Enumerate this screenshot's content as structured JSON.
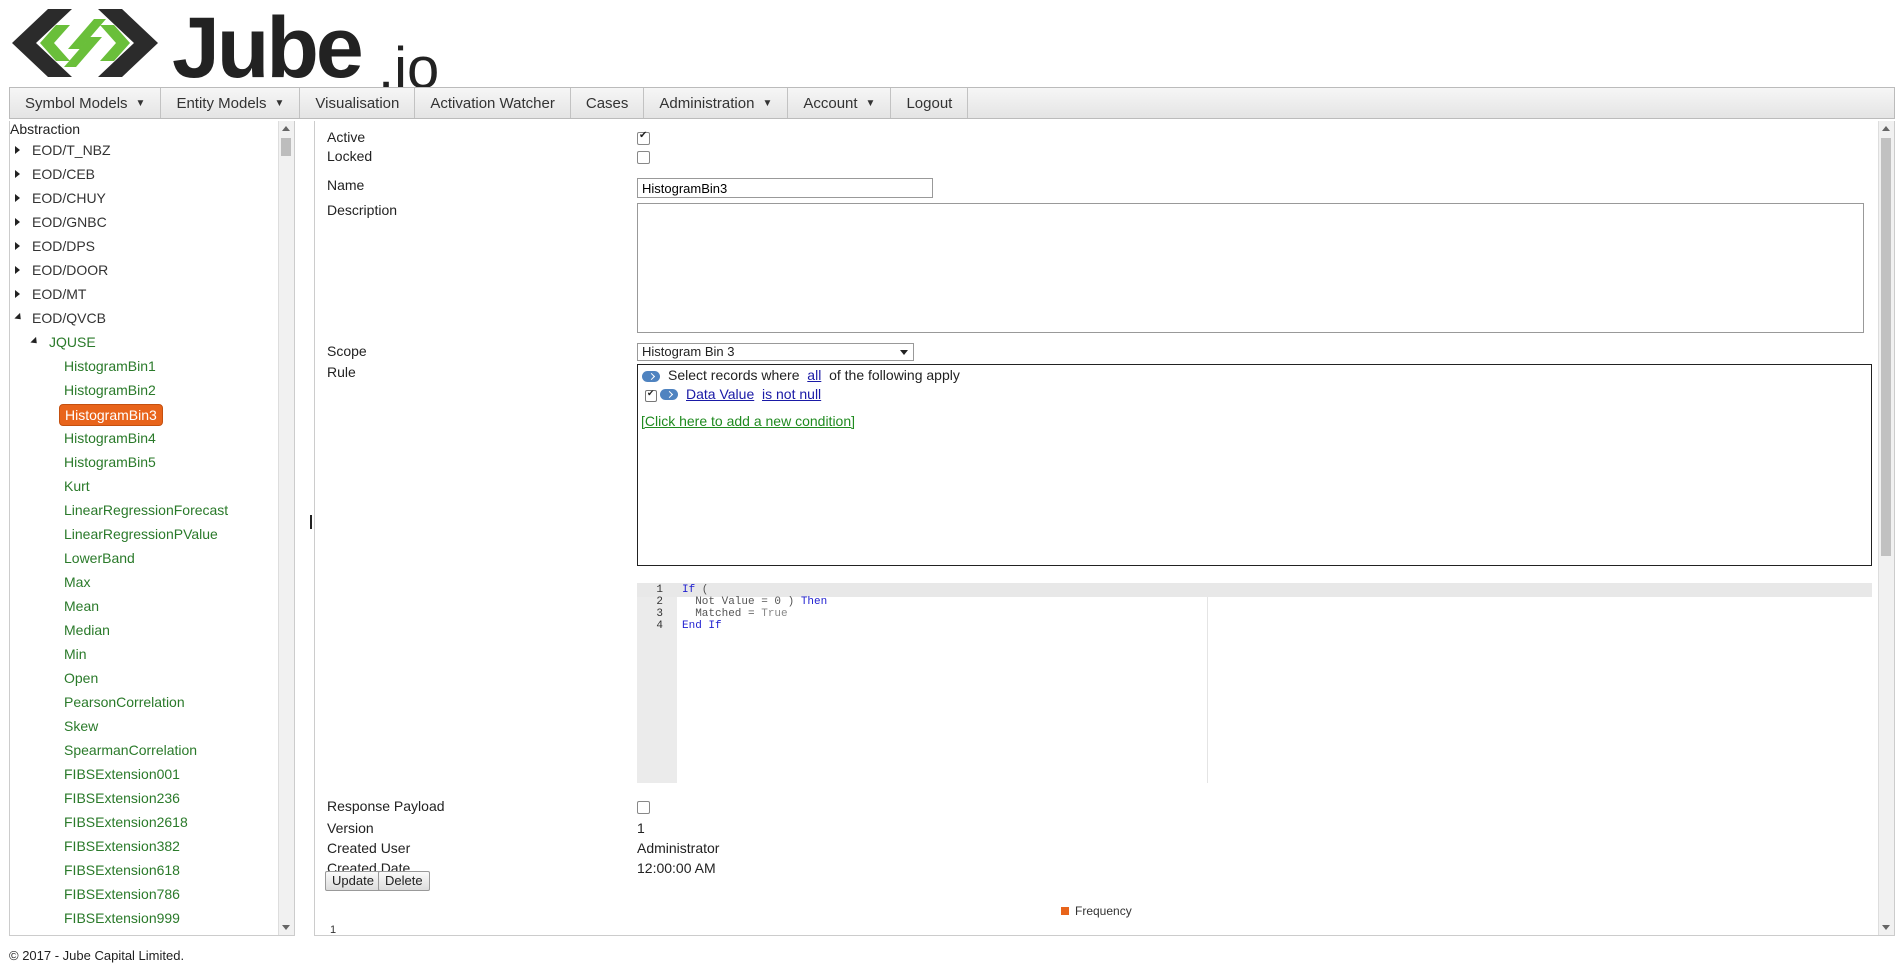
{
  "brand": {
    "logo_name": "Jube",
    "logo_suffix": ".io",
    "colors": {
      "logo_green": "#6abf3a",
      "logo_dark": "#2b2b2b",
      "accent": "#e8641b"
    }
  },
  "nav": {
    "items": [
      {
        "label": "Symbol Models",
        "dropdown": true
      },
      {
        "label": "Entity Models",
        "dropdown": true
      },
      {
        "label": "Visualisation",
        "dropdown": false
      },
      {
        "label": "Activation Watcher",
        "dropdown": false
      },
      {
        "label": "Cases",
        "dropdown": false
      },
      {
        "label": "Administration",
        "dropdown": true
      },
      {
        "label": "Account",
        "dropdown": true
      },
      {
        "label": "Logout",
        "dropdown": false
      }
    ]
  },
  "tree": {
    "root": "Abstraction",
    "nodes": [
      {
        "label": "EOD/T_NBZ",
        "level": 0,
        "expanded": false
      },
      {
        "label": "EOD/CEB",
        "level": 0,
        "expanded": false
      },
      {
        "label": "EOD/CHUY",
        "level": 0,
        "expanded": false
      },
      {
        "label": "EOD/GNBC",
        "level": 0,
        "expanded": false
      },
      {
        "label": "EOD/DPS",
        "level": 0,
        "expanded": false
      },
      {
        "label": "EOD/DOOR",
        "level": 0,
        "expanded": false
      },
      {
        "label": "EOD/MT",
        "level": 0,
        "expanded": false
      },
      {
        "label": "EOD/QVCB",
        "level": 0,
        "expanded": true
      },
      {
        "label": "JQUSE",
        "level": 1,
        "expanded": true
      },
      {
        "label": "HistogramBin1",
        "level": 2
      },
      {
        "label": "HistogramBin2",
        "level": 2
      },
      {
        "label": "HistogramBin3",
        "level": 2,
        "selected": true
      },
      {
        "label": "HistogramBin4",
        "level": 2
      },
      {
        "label": "HistogramBin5",
        "level": 2
      },
      {
        "label": "Kurt",
        "level": 2
      },
      {
        "label": "LinearRegressionForecast",
        "level": 2
      },
      {
        "label": "LinearRegressionPValue",
        "level": 2
      },
      {
        "label": "LowerBand",
        "level": 2
      },
      {
        "label": "Max",
        "level": 2
      },
      {
        "label": "Mean",
        "level": 2
      },
      {
        "label": "Median",
        "level": 2
      },
      {
        "label": "Min",
        "level": 2
      },
      {
        "label": "Open",
        "level": 2
      },
      {
        "label": "PearsonCorrelation",
        "level": 2
      },
      {
        "label": "Skew",
        "level": 2
      },
      {
        "label": "SpearmanCorrelation",
        "level": 2
      },
      {
        "label": "FIBSExtension001",
        "level": 2
      },
      {
        "label": "FIBSExtension236",
        "level": 2
      },
      {
        "label": "FIBSExtension2618",
        "level": 2
      },
      {
        "label": "FIBSExtension382",
        "level": 2
      },
      {
        "label": "FIBSExtension618",
        "level": 2
      },
      {
        "label": "FIBSExtension786",
        "level": 2
      },
      {
        "label": "FIBSExtension999",
        "level": 2
      }
    ]
  },
  "form": {
    "active_label": "Active",
    "active": true,
    "locked_label": "Locked",
    "locked": false,
    "name_label": "Name",
    "name_value": "HistogramBin3",
    "description_label": "Description",
    "description_value": "",
    "scope_label": "Scope",
    "scope_value": "Histogram Bin 3",
    "rule_label": "Rule",
    "rule": {
      "prefix": "Select records where",
      "quantifier": "all",
      "suffix": "of the following apply",
      "condition_field": "Data Value",
      "condition_op": "is not null",
      "condition_checked": true,
      "add_condition": "[Click here to add a new condition]"
    },
    "code_lines": [
      {
        "num": "1",
        "parts": [
          [
            "kw",
            "If"
          ],
          [
            "plain",
            " ("
          ]
        ]
      },
      {
        "num": "2",
        "parts": [
          [
            "plain",
            "  Not Value = 0 ) "
          ],
          [
            "kw",
            "Then"
          ]
        ]
      },
      {
        "num": "3",
        "parts": [
          [
            "plain",
            "  Matched = "
          ],
          [
            "lit",
            "True"
          ]
        ]
      },
      {
        "num": "4",
        "parts": [
          [
            "kw",
            "End If"
          ]
        ]
      }
    ],
    "response_payload_label": "Response Payload",
    "response_payload": false,
    "version_label": "Version",
    "version_value": "1",
    "created_user_label": "Created User",
    "created_user_value": "Administrator",
    "created_date_label": "Created Date",
    "created_date_value": "12:00:00 AM",
    "update_button": "Update",
    "delete_button": "Delete"
  },
  "chart": {
    "legend": "Frequency",
    "axis_first_tick": "1"
  },
  "footer": {
    "text": "© 2017 - Jube Capital Limited."
  }
}
